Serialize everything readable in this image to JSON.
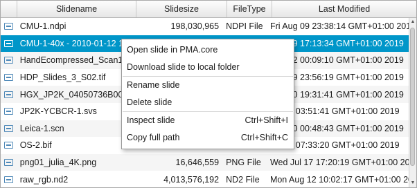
{
  "columns": [
    "",
    "Slidename",
    "Slidesize",
    "FileType",
    "Last Modified"
  ],
  "rows": [
    {
      "name": "CMU-1.ndpi",
      "size": "198,030,965",
      "type": "NDPI File",
      "modified": "Fri Aug 09 23:38:14 GMT+01:00 2019"
    },
    {
      "name": "CMU-1-40x - 2010-01-12 13.",
      "size": "",
      "type": "",
      "modified": "Aug 29 17:13:34 GMT+01:00 2019"
    },
    {
      "name": "HandEcompressed_Scan1.qp",
      "size": "",
      "type": "",
      "modified": "Aug 12 00:09:10 GMT+01:00 2019"
    },
    {
      "name": "HDP_Slides_3_S02.tif",
      "size": "",
      "type": "",
      "modified": "Aug 09 23:56:19 GMT+01:00 2019"
    },
    {
      "name": "HGX_JP2K_04050736B0045S",
      "size": "",
      "type": "",
      "modified": "Aug 10 19:31:41 GMT+01:00 2019"
    },
    {
      "name": "JP2K-YCBCR-1.svs",
      "size": "",
      "type": "",
      "modified": "Jul 17 03:51:41 GMT+01:00 2019"
    },
    {
      "name": "Leica-1.scn",
      "size": "",
      "type": "",
      "modified": "Aug 10 00:48:43 GMT+01:00 2019"
    },
    {
      "name": "OS-2.bif",
      "size": "",
      "type": "",
      "modified": "Jul 17 07:33:20 GMT+01:00 2019"
    },
    {
      "name": "png01_julia_4K.png",
      "size": "16,646,559",
      "type": "PNG File",
      "modified": "Wed Jul 17 17:20:19 GMT+01:00 2019"
    },
    {
      "name": "raw_rgb.nd2",
      "size": "4,013,576,192",
      "type": "ND2 File",
      "modified": "Mon Aug 12 10:02:17 GMT+01:00 2019"
    }
  ],
  "menu": {
    "open": "Open slide in PMA.core",
    "download": "Download slide to local folder",
    "rename": "Rename slide",
    "delete": "Delete slide",
    "inspect": "Inspect slide",
    "inspect_accel": "Ctrl+Shift+I",
    "copy": "Copy full path",
    "copy_accel": "Ctrl+Shift+C"
  },
  "scrollbar": {
    "up_icon": "arrow-up-icon",
    "down_icon": "arrow-down-icon"
  },
  "colors": {
    "selection": "#0096c9",
    "alt_row": "#f5f5f5"
  }
}
